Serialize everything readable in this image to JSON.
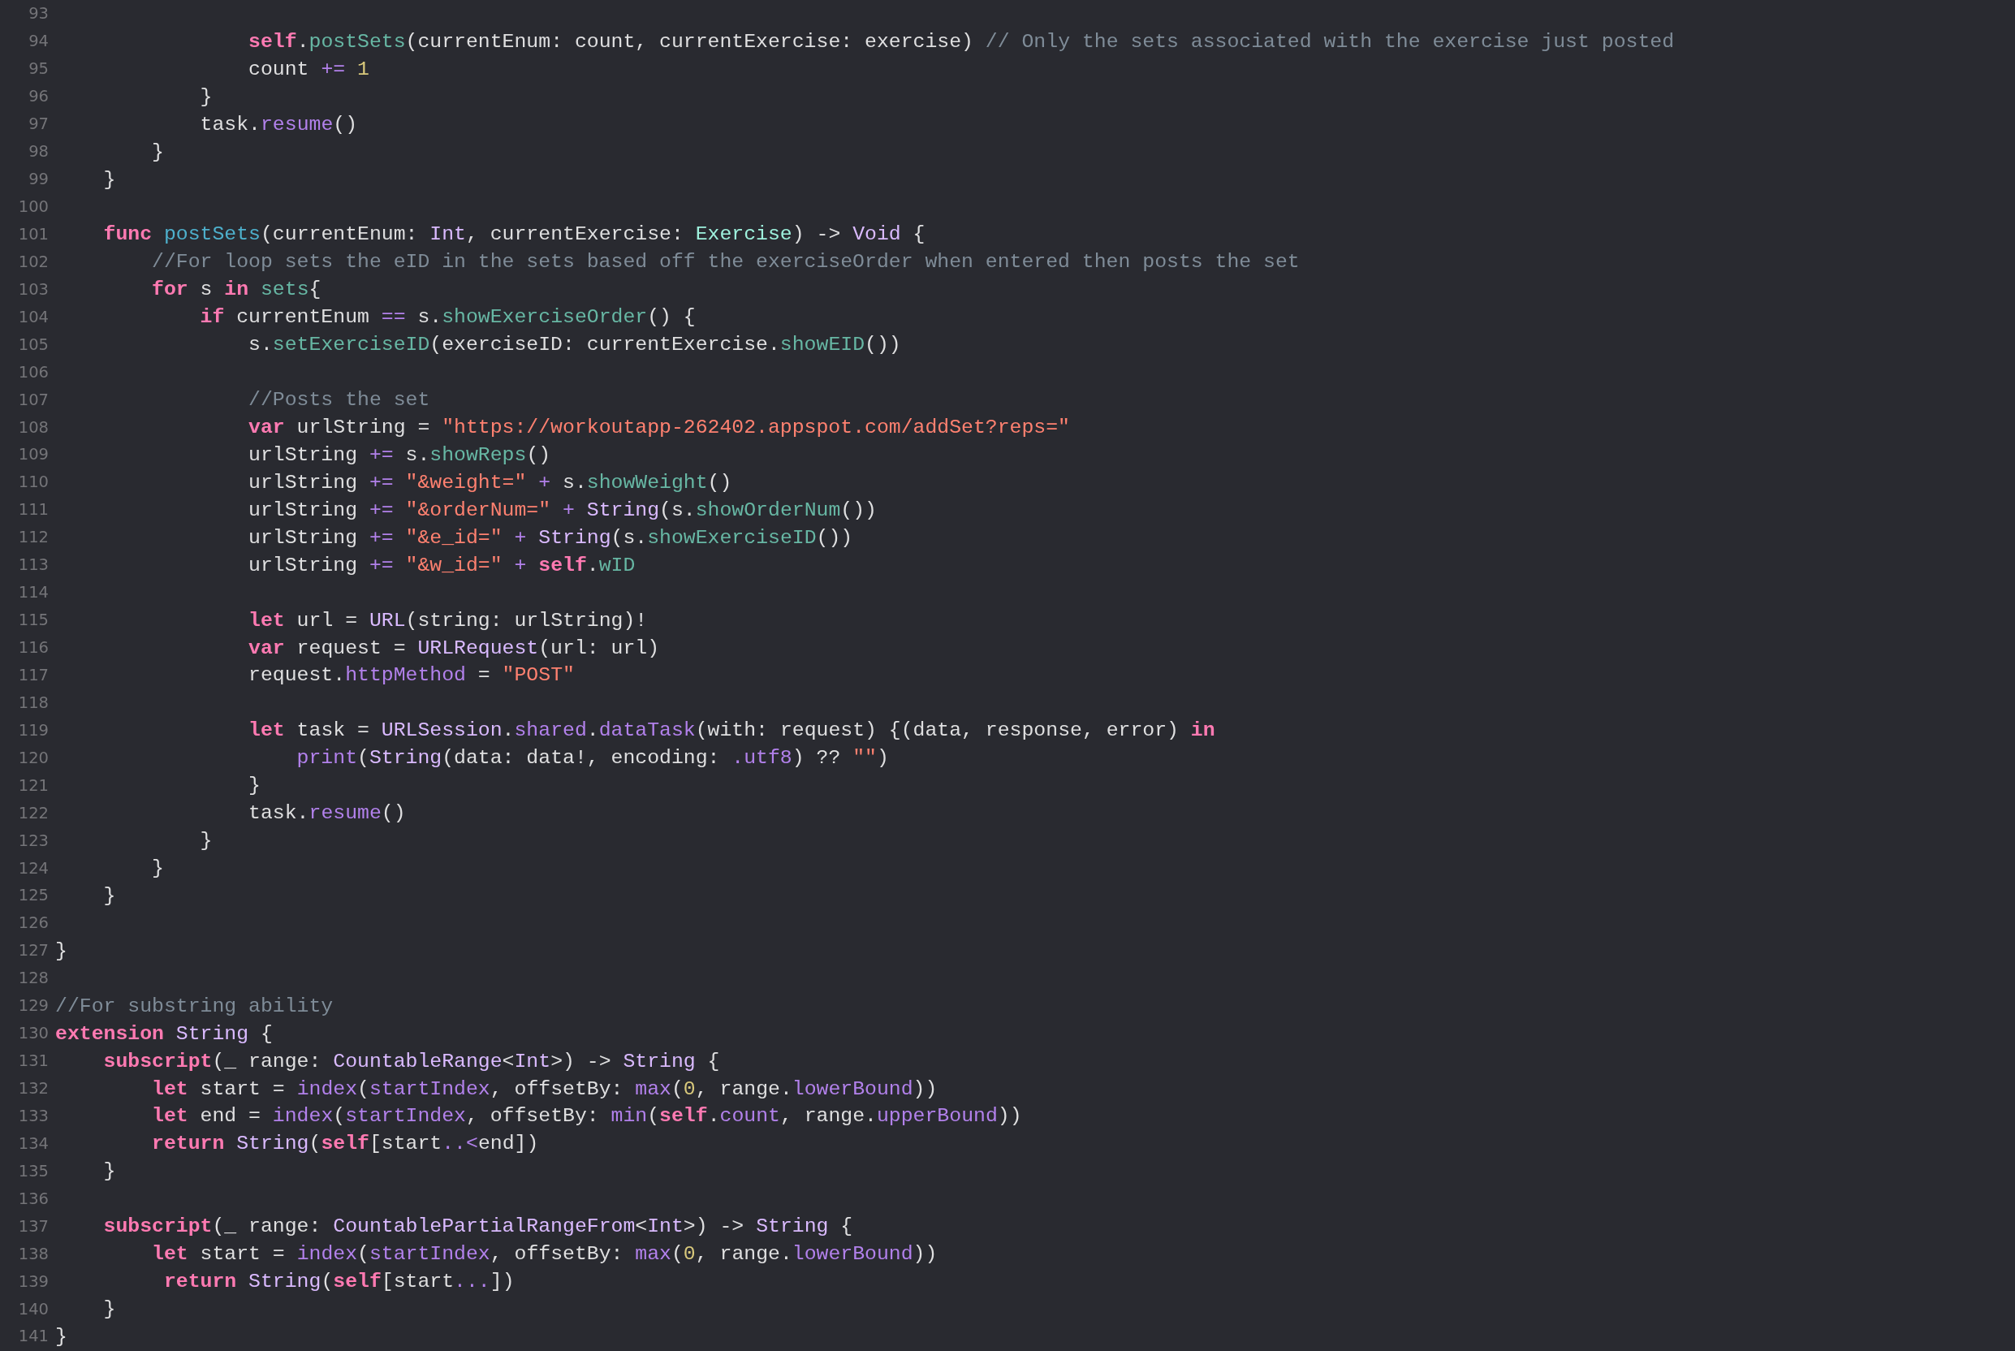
{
  "editor": {
    "lines": [
      {
        "number": "93"
      },
      {
        "number": "94",
        "tokens": [
          {
            "kind": "keyword",
            "text": "                self"
          },
          {
            "kind": "plain",
            "text": "."
          },
          {
            "kind": "project-member",
            "text": "postSets"
          },
          {
            "kind": "plain",
            "text": "(currentEnum: count, currentExercise: exercise) "
          },
          {
            "kind": "comment",
            "text": "// Only the sets associated with the exercise just posted"
          }
        ]
      },
      {
        "number": "95",
        "tokens": [
          {
            "kind": "plain",
            "text": "                count "
          },
          {
            "kind": "operator",
            "text": "+="
          },
          {
            "kind": "number",
            "text": " 1"
          }
        ]
      },
      {
        "number": "96",
        "tokens": [
          {
            "kind": "plain",
            "text": "            }"
          }
        ]
      },
      {
        "number": "97",
        "tokens": [
          {
            "kind": "plain",
            "text": "            task."
          },
          {
            "kind": "system-member",
            "text": "resume"
          },
          {
            "kind": "plain",
            "text": "()"
          }
        ]
      },
      {
        "number": "98",
        "tokens": [
          {
            "kind": "plain",
            "text": "        }"
          }
        ]
      },
      {
        "number": "99",
        "tokens": [
          {
            "kind": "plain",
            "text": "    }"
          }
        ]
      },
      {
        "number": "100"
      },
      {
        "number": "101",
        "tokens": [
          {
            "kind": "keyword",
            "text": "    func"
          },
          {
            "kind": "declaration",
            "text": " postSets"
          },
          {
            "kind": "plain",
            "text": "(currentEnum: "
          },
          {
            "kind": "system-type",
            "text": "Int"
          },
          {
            "kind": "plain",
            "text": ", currentExercise: "
          },
          {
            "kind": "project-type",
            "text": "Exercise"
          },
          {
            "kind": "plain",
            "text": ") -> "
          },
          {
            "kind": "system-type",
            "text": "Void"
          },
          {
            "kind": "plain",
            "text": " {"
          }
        ]
      },
      {
        "number": "102",
        "tokens": [
          {
            "kind": "comment",
            "text": "        //For loop sets the eID in the sets based off the exerciseOrder when entered then posts the set"
          }
        ]
      },
      {
        "number": "103",
        "tokens": [
          {
            "kind": "keyword",
            "text": "        for"
          },
          {
            "kind": "plain",
            "text": " s "
          },
          {
            "kind": "keyword",
            "text": "in"
          },
          {
            "kind": "project-member",
            "text": " sets"
          },
          {
            "kind": "plain",
            "text": "{"
          }
        ]
      },
      {
        "number": "104",
        "tokens": [
          {
            "kind": "keyword",
            "text": "            if"
          },
          {
            "kind": "plain",
            "text": " currentEnum "
          },
          {
            "kind": "operator",
            "text": "=="
          },
          {
            "kind": "plain",
            "text": " s."
          },
          {
            "kind": "project-member",
            "text": "showExerciseOrder"
          },
          {
            "kind": "plain",
            "text": "() {"
          }
        ]
      },
      {
        "number": "105",
        "tokens": [
          {
            "kind": "plain",
            "text": "                s."
          },
          {
            "kind": "project-member",
            "text": "setExerciseID"
          },
          {
            "kind": "plain",
            "text": "(exerciseID: currentExercise."
          },
          {
            "kind": "project-member",
            "text": "showEID"
          },
          {
            "kind": "plain",
            "text": "())"
          }
        ]
      },
      {
        "number": "106"
      },
      {
        "number": "107",
        "tokens": [
          {
            "kind": "comment",
            "text": "                //Posts the set"
          }
        ]
      },
      {
        "number": "108",
        "tokens": [
          {
            "kind": "keyword",
            "text": "                var"
          },
          {
            "kind": "plain",
            "text": " urlString = "
          },
          {
            "kind": "string",
            "text": "\"https://workoutapp-262402.appspot.com/addSet?reps=\""
          }
        ]
      },
      {
        "number": "109",
        "tokens": [
          {
            "kind": "plain",
            "text": "                urlString "
          },
          {
            "kind": "operator",
            "text": "+="
          },
          {
            "kind": "plain",
            "text": " s."
          },
          {
            "kind": "project-member",
            "text": "showReps"
          },
          {
            "kind": "plain",
            "text": "()"
          }
        ]
      },
      {
        "number": "110",
        "tokens": [
          {
            "kind": "plain",
            "text": "                urlString "
          },
          {
            "kind": "operator",
            "text": "+="
          },
          {
            "kind": "string",
            "text": " \"&weight=\""
          },
          {
            "kind": "operator",
            "text": " +"
          },
          {
            "kind": "plain",
            "text": " s."
          },
          {
            "kind": "project-member",
            "text": "showWeight"
          },
          {
            "kind": "plain",
            "text": "()"
          }
        ]
      },
      {
        "number": "111",
        "tokens": [
          {
            "kind": "plain",
            "text": "                urlString "
          },
          {
            "kind": "operator",
            "text": "+="
          },
          {
            "kind": "string",
            "text": " \"&orderNum=\""
          },
          {
            "kind": "operator",
            "text": " +"
          },
          {
            "kind": "system-type",
            "text": " String"
          },
          {
            "kind": "plain",
            "text": "(s."
          },
          {
            "kind": "project-member",
            "text": "showOrderNum"
          },
          {
            "kind": "plain",
            "text": "())"
          }
        ]
      },
      {
        "number": "112",
        "tokens": [
          {
            "kind": "plain",
            "text": "                urlString "
          },
          {
            "kind": "operator",
            "text": "+="
          },
          {
            "kind": "string",
            "text": " \"&e_id=\""
          },
          {
            "kind": "operator",
            "text": " +"
          },
          {
            "kind": "system-type",
            "text": " String"
          },
          {
            "kind": "plain",
            "text": "(s."
          },
          {
            "kind": "project-member",
            "text": "showExerciseID"
          },
          {
            "kind": "plain",
            "text": "())"
          }
        ]
      },
      {
        "number": "113",
        "tokens": [
          {
            "kind": "plain",
            "text": "                urlString "
          },
          {
            "kind": "operator",
            "text": "+="
          },
          {
            "kind": "string",
            "text": " \"&w_id=\""
          },
          {
            "kind": "operator",
            "text": " +"
          },
          {
            "kind": "keyword",
            "text": " self"
          },
          {
            "kind": "plain",
            "text": "."
          },
          {
            "kind": "project-member",
            "text": "wID"
          }
        ]
      },
      {
        "number": "114"
      },
      {
        "number": "115",
        "tokens": [
          {
            "kind": "keyword",
            "text": "                let"
          },
          {
            "kind": "plain",
            "text": " url = "
          },
          {
            "kind": "system-type",
            "text": "URL"
          },
          {
            "kind": "plain",
            "text": "(string: urlString)!"
          }
        ]
      },
      {
        "number": "116",
        "tokens": [
          {
            "kind": "keyword",
            "text": "                var"
          },
          {
            "kind": "plain",
            "text": " request = "
          },
          {
            "kind": "system-type",
            "text": "URLRequest"
          },
          {
            "kind": "plain",
            "text": "(url: url)"
          }
        ]
      },
      {
        "number": "117",
        "tokens": [
          {
            "kind": "plain",
            "text": "                request."
          },
          {
            "kind": "system-member",
            "text": "httpMethod"
          },
          {
            "kind": "plain",
            "text": " = "
          },
          {
            "kind": "string",
            "text": "\"POST\""
          }
        ]
      },
      {
        "number": "118"
      },
      {
        "number": "119",
        "tokens": [
          {
            "kind": "keyword",
            "text": "                let"
          },
          {
            "kind": "plain",
            "text": " task = "
          },
          {
            "kind": "system-type",
            "text": "URLSession"
          },
          {
            "kind": "plain",
            "text": "."
          },
          {
            "kind": "system-member",
            "text": "shared"
          },
          {
            "kind": "plain",
            "text": "."
          },
          {
            "kind": "system-member",
            "text": "dataTask"
          },
          {
            "kind": "plain",
            "text": "(with: request) {(data, response, error) "
          },
          {
            "kind": "keyword",
            "text": "in"
          }
        ]
      },
      {
        "number": "120",
        "tokens": [
          {
            "kind": "system-member",
            "text": "                    print"
          },
          {
            "kind": "plain",
            "text": "("
          },
          {
            "kind": "system-type",
            "text": "String"
          },
          {
            "kind": "plain",
            "text": "(data: data!, encoding: "
          },
          {
            "kind": "system-member",
            "text": ".utf8"
          },
          {
            "kind": "plain",
            "text": ") ?? "
          },
          {
            "kind": "string",
            "text": "\"\""
          },
          {
            "kind": "plain",
            "text": ")"
          }
        ]
      },
      {
        "number": "121",
        "tokens": [
          {
            "kind": "plain",
            "text": "                }"
          }
        ]
      },
      {
        "number": "122",
        "tokens": [
          {
            "kind": "plain",
            "text": "                task."
          },
          {
            "kind": "system-member",
            "text": "resume"
          },
          {
            "kind": "plain",
            "text": "()"
          }
        ]
      },
      {
        "number": "123",
        "tokens": [
          {
            "kind": "plain",
            "text": "            }"
          }
        ]
      },
      {
        "number": "124",
        "tokens": [
          {
            "kind": "plain",
            "text": "        }"
          }
        ]
      },
      {
        "number": "125",
        "tokens": [
          {
            "kind": "plain",
            "text": "    }"
          }
        ]
      },
      {
        "number": "126"
      },
      {
        "number": "127",
        "tokens": [
          {
            "kind": "plain",
            "text": "}"
          }
        ]
      },
      {
        "number": "128"
      },
      {
        "number": "129",
        "tokens": [
          {
            "kind": "comment",
            "text": "//For substring ability"
          }
        ]
      },
      {
        "number": "130",
        "tokens": [
          {
            "kind": "keyword",
            "text": "extension"
          },
          {
            "kind": "system-type",
            "text": " String"
          },
          {
            "kind": "plain",
            "text": " {"
          }
        ]
      },
      {
        "number": "131",
        "tokens": [
          {
            "kind": "keyword",
            "text": "    subscript"
          },
          {
            "kind": "plain",
            "text": "(_ range: "
          },
          {
            "kind": "system-type",
            "text": "CountableRange"
          },
          {
            "kind": "plain",
            "text": "<"
          },
          {
            "kind": "system-type",
            "text": "Int"
          },
          {
            "kind": "plain",
            "text": ">) -> "
          },
          {
            "kind": "system-type",
            "text": "String"
          },
          {
            "kind": "plain",
            "text": " {"
          }
        ]
      },
      {
        "number": "132",
        "tokens": [
          {
            "kind": "keyword",
            "text": "        let"
          },
          {
            "kind": "plain",
            "text": " start = "
          },
          {
            "kind": "system-member",
            "text": "index"
          },
          {
            "kind": "plain",
            "text": "("
          },
          {
            "kind": "system-member",
            "text": "startIndex"
          },
          {
            "kind": "plain",
            "text": ", offsetBy: "
          },
          {
            "kind": "system-member",
            "text": "max"
          },
          {
            "kind": "plain",
            "text": "("
          },
          {
            "kind": "number",
            "text": "0"
          },
          {
            "kind": "plain",
            "text": ", range."
          },
          {
            "kind": "system-member",
            "text": "lowerBound"
          },
          {
            "kind": "plain",
            "text": "))"
          }
        ]
      },
      {
        "number": "133",
        "tokens": [
          {
            "kind": "keyword",
            "text": "        let"
          },
          {
            "kind": "plain",
            "text": " end = "
          },
          {
            "kind": "system-member",
            "text": "index"
          },
          {
            "kind": "plain",
            "text": "("
          },
          {
            "kind": "system-member",
            "text": "startIndex"
          },
          {
            "kind": "plain",
            "text": ", offsetBy: "
          },
          {
            "kind": "system-member",
            "text": "min"
          },
          {
            "kind": "plain",
            "text": "("
          },
          {
            "kind": "keyword",
            "text": "self"
          },
          {
            "kind": "plain",
            "text": "."
          },
          {
            "kind": "system-member",
            "text": "count"
          },
          {
            "kind": "plain",
            "text": ", range."
          },
          {
            "kind": "system-member",
            "text": "upperBound"
          },
          {
            "kind": "plain",
            "text": "))"
          }
        ]
      },
      {
        "number": "134",
        "tokens": [
          {
            "kind": "keyword",
            "text": "        return"
          },
          {
            "kind": "system-type",
            "text": " String"
          },
          {
            "kind": "plain",
            "text": "("
          },
          {
            "kind": "keyword",
            "text": "self"
          },
          {
            "kind": "plain",
            "text": "[start"
          },
          {
            "kind": "operator",
            "text": "..<"
          },
          {
            "kind": "plain",
            "text": "end])"
          }
        ]
      },
      {
        "number": "135",
        "tokens": [
          {
            "kind": "plain",
            "text": "    }"
          }
        ]
      },
      {
        "number": "136"
      },
      {
        "number": "137",
        "tokens": [
          {
            "kind": "keyword",
            "text": "    subscript"
          },
          {
            "kind": "plain",
            "text": "(_ range: "
          },
          {
            "kind": "system-type",
            "text": "CountablePartialRangeFrom"
          },
          {
            "kind": "plain",
            "text": "<"
          },
          {
            "kind": "system-type",
            "text": "Int"
          },
          {
            "kind": "plain",
            "text": ">) -> "
          },
          {
            "kind": "system-type",
            "text": "String"
          },
          {
            "kind": "plain",
            "text": " {"
          }
        ]
      },
      {
        "number": "138",
        "tokens": [
          {
            "kind": "keyword",
            "text": "        let"
          },
          {
            "kind": "plain",
            "text": " start = "
          },
          {
            "kind": "system-member",
            "text": "index"
          },
          {
            "kind": "plain",
            "text": "("
          },
          {
            "kind": "system-member",
            "text": "startIndex"
          },
          {
            "kind": "plain",
            "text": ", offsetBy: "
          },
          {
            "kind": "system-member",
            "text": "max"
          },
          {
            "kind": "plain",
            "text": "("
          },
          {
            "kind": "number",
            "text": "0"
          },
          {
            "kind": "plain",
            "text": ", range."
          },
          {
            "kind": "system-member",
            "text": "lowerBound"
          },
          {
            "kind": "plain",
            "text": "))"
          }
        ]
      },
      {
        "number": "139",
        "tokens": [
          {
            "kind": "keyword",
            "text": "         return"
          },
          {
            "kind": "system-type",
            "text": " String"
          },
          {
            "kind": "plain",
            "text": "("
          },
          {
            "kind": "keyword",
            "text": "self"
          },
          {
            "kind": "plain",
            "text": "[start"
          },
          {
            "kind": "operator",
            "text": "..."
          },
          {
            "kind": "plain",
            "text": "])"
          }
        ]
      },
      {
        "number": "140",
        "tokens": [
          {
            "kind": "plain",
            "text": "    }"
          }
        ]
      },
      {
        "number": "141",
        "tokens": [
          {
            "kind": "plain",
            "text": "}"
          }
        ]
      }
    ]
  }
}
